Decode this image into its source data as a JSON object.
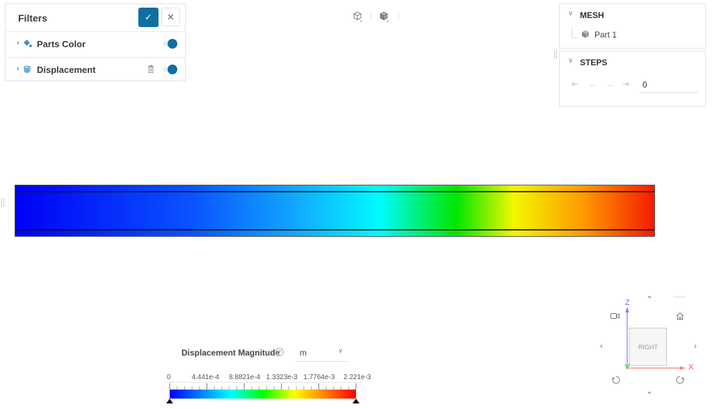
{
  "filters": {
    "title": "Filters",
    "apply_label": "✓",
    "close_label": "✕",
    "items": [
      {
        "label": "Parts Color",
        "icon": "paint-bucket-icon",
        "enabled": true,
        "deletable": false
      },
      {
        "label": "Displacement",
        "icon": "displacement-icon",
        "enabled": true,
        "deletable": true
      }
    ]
  },
  "view_toolbar": {
    "buttons": [
      {
        "icon": "wireframe-cube-icon"
      },
      {
        "icon": "solid-cube-icon"
      }
    ]
  },
  "mesh": {
    "title": "MESH",
    "parts": [
      {
        "label": "Part 1",
        "icon": "part-cube-icon"
      }
    ]
  },
  "steps": {
    "title": "STEPS",
    "nav": [
      {
        "icon": "first-step-icon",
        "glyph": "⇤"
      },
      {
        "icon": "prev-step-icon",
        "glyph": "←"
      },
      {
        "icon": "next-step-icon",
        "glyph": "→"
      },
      {
        "icon": "last-step-icon",
        "glyph": "⇥"
      }
    ],
    "current": "0"
  },
  "legend": {
    "title": "Displacement Magnitude",
    "info_glyph": "≡",
    "unit": "m",
    "unit_chevron": "⌄",
    "ticks": [
      "0",
      "4.441e-4",
      "8.8821e-4",
      "1.3323e-3",
      "1.7764e-3",
      "2.221e-3"
    ],
    "min": 0,
    "max": 0.002221,
    "colormap": [
      "#0000ff",
      "#0080ff",
      "#00ffff",
      "#00ff00",
      "#ffff00",
      "#ff8000",
      "#ff0000"
    ]
  },
  "result": {
    "colormap_stops": [
      {
        "pos": 0.0,
        "color": "#0000f5"
      },
      {
        "pos": 0.28,
        "color": "#0a55ff"
      },
      {
        "pos": 0.44,
        "color": "#12a8ff"
      },
      {
        "pos": 0.57,
        "color": "#00fbff"
      },
      {
        "pos": 0.69,
        "color": "#00e600"
      },
      {
        "pos": 0.78,
        "color": "#f2f700"
      },
      {
        "pos": 0.89,
        "color": "#ff9900"
      },
      {
        "pos": 1.0,
        "color": "#f51a00"
      }
    ]
  },
  "navcube": {
    "face_label": "RIGHT",
    "axis_z": "Z",
    "axis_x": "X",
    "up": "⌃",
    "down": "⌄",
    "left": "‹",
    "right": "›",
    "camera_icon": "camera-icon",
    "home_icon": "home-icon",
    "rotate_ccw_icon": "rotate-ccw-icon",
    "rotate_cw_icon": "rotate-cw-icon"
  }
}
